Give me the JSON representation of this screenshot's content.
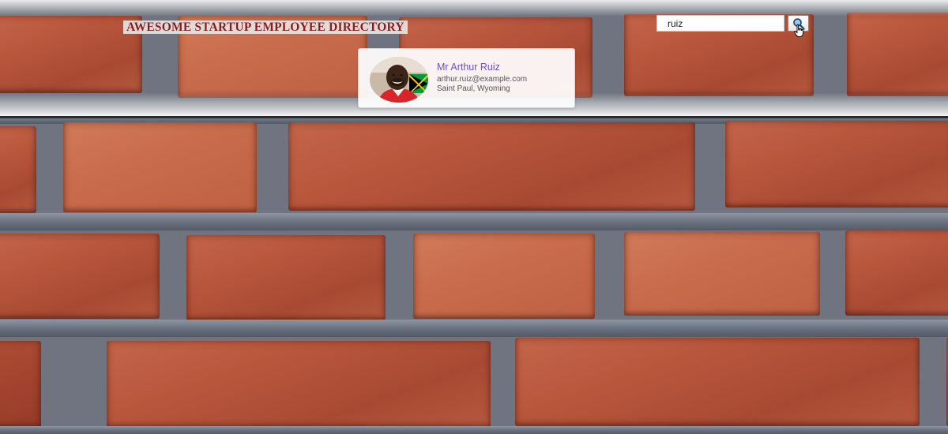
{
  "header": {
    "title": "AWESOME STARTUP EMPLOYEE DIRECTORY"
  },
  "search": {
    "value": "ruiz",
    "button_icon": "search-icon"
  },
  "results": [
    {
      "name": "Mr Arthur Ruiz",
      "email": "arthur.ruiz@example.com",
      "location": "Saint Paul, Wyoming",
      "avatar_icon": "avatar-photo"
    }
  ],
  "colors": {
    "title_text": "#8b1a1a",
    "name_text": "#6a52c8",
    "brick": "#b8563c",
    "mortar": "#6b7280"
  }
}
